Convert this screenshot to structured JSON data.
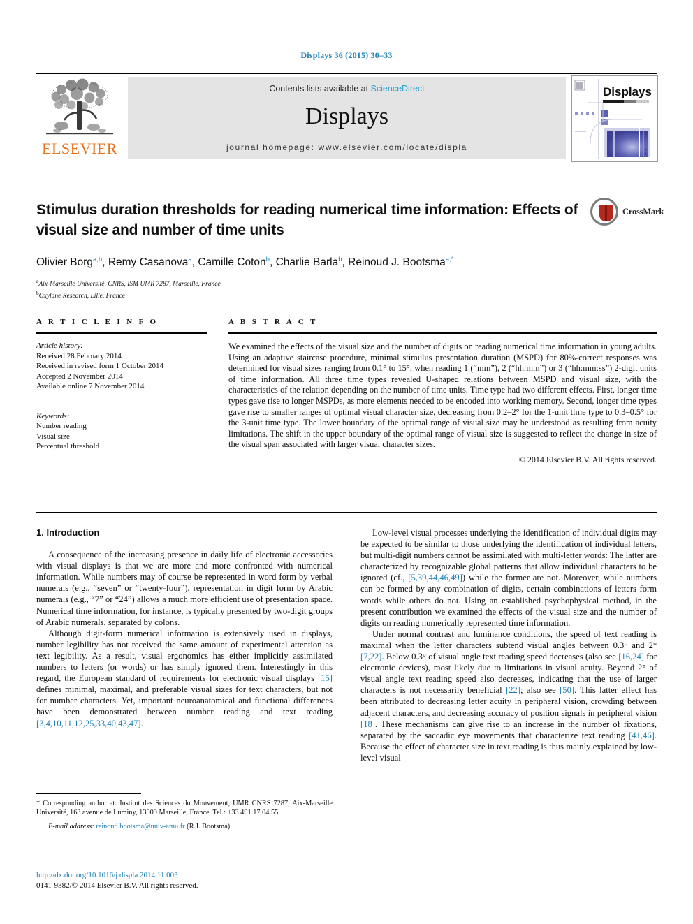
{
  "running_head": "Displays 36 (2015) 30–33",
  "masthead": {
    "publisher": "ELSEVIER",
    "contents_prefix": "Contents lists available at ",
    "sciencedirect": "ScienceDirect",
    "journal_name": "Displays",
    "homepage": "journal homepage: www.elsevier.com/locate/displa",
    "cover_title": "Displays"
  },
  "article": {
    "title": "Stimulus duration thresholds for reading numerical time information: Effects of visual size and number of time units",
    "authors": [
      {
        "name": "Olivier Borg",
        "marks": "a,b",
        "sep": ", "
      },
      {
        "name": "Remy Casanova",
        "marks": "a",
        "sep": ", "
      },
      {
        "name": "Camille Coton",
        "marks": "b",
        "sep": ", "
      },
      {
        "name": "Charlie Barla",
        "marks": "b",
        "sep": ", "
      },
      {
        "name": "Reinoud J. Bootsma",
        "marks": "a,*",
        "sep": ""
      }
    ],
    "affiliations": [
      {
        "mark": "a",
        "text": "Aix-Marseille Université, CNRS, ISM UMR 7287, Marseille, France"
      },
      {
        "mark": "b",
        "text": "Oxylane Research, Lille, France"
      }
    ],
    "crossmark_label": "CrossMark"
  },
  "article_info": {
    "heading": "A R T I C L E    I N F O",
    "history_lead": "Article history:",
    "history": [
      "Received 28 February 2014",
      "Received in revised form 1 October 2014",
      "Accepted 2 November 2014",
      "Available online 7 November 2014"
    ],
    "keywords_lead": "Keywords:",
    "keywords": [
      "Number reading",
      "Visual size",
      "Perceptual threshold"
    ]
  },
  "abstract": {
    "heading": "A B S T R A C T",
    "text": "We examined the effects of the visual size and the number of digits on reading numerical time information in young adults. Using an adaptive staircase procedure, minimal stimulus presentation duration (MSPD) for 80%-correct responses was determined for visual sizes ranging from 0.1° to 15°, when reading 1 (“mm”), 2 (“hh:mm”) or 3 (“hh:mm:ss”) 2-digit units of time information. All three time types revealed U-shaped relations between MSPD and visual size, with the characteristics of the relation depending on the number of time units. Time type had two different effects. First, longer time types gave rise to longer MSPDs, as more elements needed to be encoded into working memory. Second, longer time types gave rise to smaller ranges of optimal visual character size, decreasing from 0.2–2° for the 1-unit time type to 0.3–0.5° for the 3-unit time type. The lower boundary of the optimal range of visual size may be understood as resulting from acuity limitations. The shift in the upper boundary of the optimal range of visual size is suggested to reflect the change in size of the visual span associated with larger visual character sizes.",
    "copyright": "© 2014 Elsevier B.V. All rights reserved."
  },
  "body": {
    "section_heading": "1. Introduction",
    "left_paragraph_1": "A consequence of the increasing presence in daily life of electronic accessories with visual displays is that we are more and more confronted with numerical information. While numbers may of course be represented in word form by verbal numerals (e.g., “seven” or “twenty-four”), representation in digit form by Arabic numerals (e.g., “7” or “24”) allows a much more efficient use of presentation space. Numerical time information, for instance, is typically presented by two-digit groups of Arabic numerals, separated by colons.",
    "left_paragraph_2_a": "Although digit-form numerical information is extensively used in displays, number legibility has not received the same amount of experimental attention as text legibility. As a result, visual ergonomics has either implicitly assimilated numbers to letters (or words) or has simply ignored them. Interestingly in this regard, the European standard of requirements for electronic visual displays ",
    "left_paragraph_2_cite_1": "[15]",
    "left_paragraph_2_b": " defines minimal, maximal, and preferable visual sizes for text characters, but not for number characters. Yet, important neuroanatomical and functional differences have been demonstrated between number reading and text reading ",
    "left_paragraph_2_cite_2": "[3,4,10,11,12,25,33,40,43,47]",
    "left_paragraph_2_c": ".",
    "right_paragraph_1_a": "Low-level visual processes underlying the identification of individual digits may be expected to be similar to those underlying the identification of individual letters, but multi-digit numbers cannot be assimilated with multi-letter words: The latter are characterized by recognizable global patterns that allow individual characters to be ignored (cf., ",
    "right_paragraph_1_cite_1": "[5,39,44,46,49]",
    "right_paragraph_1_b": ") while the former are not. Moreover, while numbers can be formed by any combination of digits, certain combinations of letters form words while others do not. Using an established psychophysical method, in the present contribution we examined the effects of the visual size and the number of digits on reading numerically represented time information.",
    "right_paragraph_2_a": "Under normal contrast and luminance conditions, the speed of text reading is maximal when the letter characters subtend visual angles between 0.3° and 2° ",
    "right_paragraph_2_cite_1": "[7,22]",
    "right_paragraph_2_b": ". Below 0.3° of visual angle text reading speed decreases (also see ",
    "right_paragraph_2_cite_2": "[16,24]",
    "right_paragraph_2_c": " for electronic devices), most likely due to limitations in visual acuity. Beyond 2° of visual angle text reading speed also decreases, indicating that the use of larger characters is not necessarily beneficial ",
    "right_paragraph_2_cite_3": "[22]",
    "right_paragraph_2_d": "; also see ",
    "right_paragraph_2_cite_4": "[50]",
    "right_paragraph_2_e": ". This latter effect has been attributed to decreasing letter acuity in peripheral vision, crowding between adjacent characters, and decreasing accuracy of position signals in peripheral vision ",
    "right_paragraph_2_cite_5": "[18]",
    "right_paragraph_2_f": ". These mechanisms can give rise to an increase in the number of fixations, separated by the saccadic eye movements that characterize text reading ",
    "right_paragraph_2_cite_6": "[41,46]",
    "right_paragraph_2_g": ". Because the effect of character size in text reading is thus mainly explained by low-level visual"
  },
  "footnote": {
    "marker": "*",
    "corresponding": " Corresponding author at: Institut des Sciences du Mouvement, UMR CNRS 7287, Aix-Marseille Université, 163 avenue de Luminy, 13009 Marseille, France. Tel.: +33 491 17 04 55.",
    "email_lead": "E-mail address:",
    "email": "reinoud.bootsma@univ-amu.fr",
    "email_suffix": " (R.J. Bootsma)."
  },
  "doi": {
    "url": "http://dx.doi.org/10.1016/j.displa.2014.11.003",
    "issn_line": "0141-9382/© 2014 Elsevier B.V. All rights reserved."
  }
}
